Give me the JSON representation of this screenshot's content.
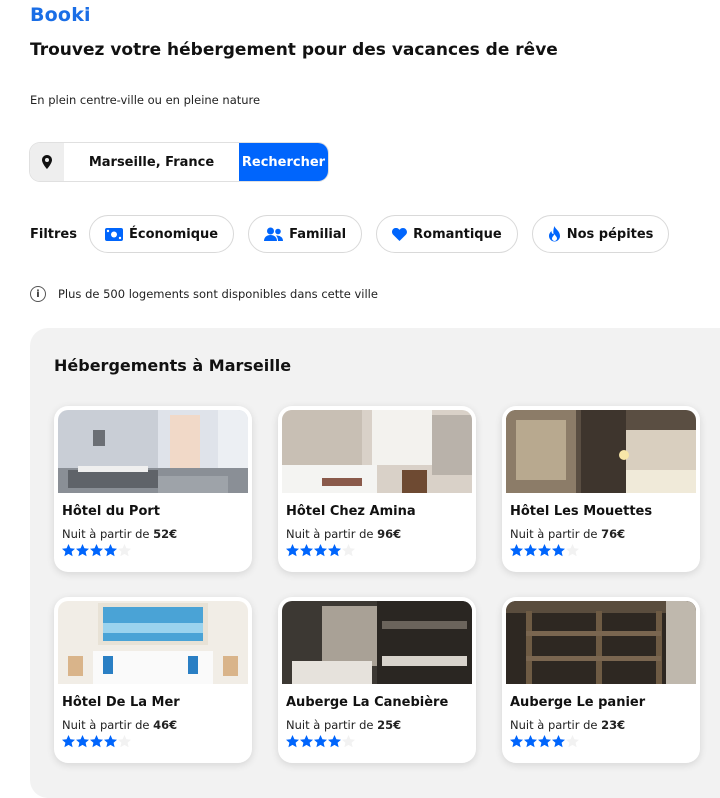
{
  "logo": "Booki",
  "header": {
    "title": "Trouvez votre hébergement pour des vacances de rêve",
    "subtitle": "En plein centre-ville ou en pleine nature"
  },
  "search": {
    "value": "Marseille, France",
    "button_label": "Rechercher",
    "icon": "location-pin-icon"
  },
  "filters": {
    "label": "Filtres",
    "items": [
      {
        "label": "Économique",
        "icon": "money-bill-icon"
      },
      {
        "label": "Familial",
        "icon": "people-icon"
      },
      {
        "label": "Romantique",
        "icon": "heart-icon"
      },
      {
        "label": "Nos pépites",
        "icon": "fire-icon"
      }
    ]
  },
  "info": "Plus de 500 logements sont disponibles dans cette ville",
  "listing": {
    "title": "Hébergements à Marseille",
    "price_prefix": "Nuit à partir de ",
    "hotels": [
      {
        "name": "Hôtel du Port",
        "price": "52€",
        "stars": 4
      },
      {
        "name": "Hôtel Chez Amina",
        "price": "96€",
        "stars": 4
      },
      {
        "name": "Hôtel Les Mouettes",
        "price": "76€",
        "stars": 4
      },
      {
        "name": "Hôtel De La Mer",
        "price": "46€",
        "stars": 4
      },
      {
        "name": "Auberge La Canebière",
        "price": "25€",
        "stars": 4
      },
      {
        "name": "Auberge Le panier",
        "price": "23€",
        "stars": 4
      }
    ]
  },
  "colors": {
    "accent": "#0065fc",
    "star_on": "#0065fc",
    "star_off": "#f2f2f2",
    "panel_bg": "#f2f2f2"
  }
}
